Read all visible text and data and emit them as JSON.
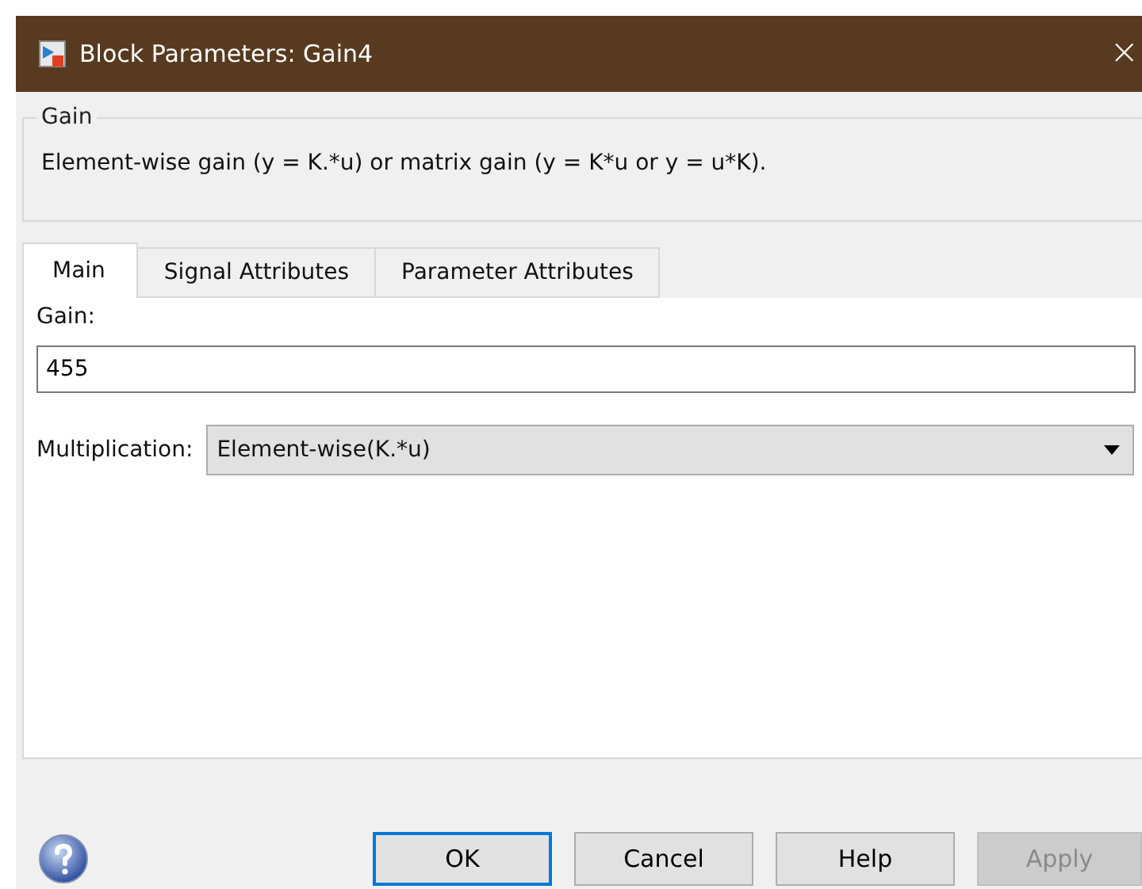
{
  "window": {
    "title": "Block Parameters: Gain4",
    "close": "×"
  },
  "group": {
    "title": "Gain",
    "description": "Element-wise gain (y = K.*u) or matrix gain (y = K*u or y = u*K)."
  },
  "tabs": [
    {
      "label": "Main",
      "selected": true
    },
    {
      "label": "Signal Attributes",
      "selected": false
    },
    {
      "label": "Parameter Attributes",
      "selected": false
    }
  ],
  "gain": {
    "label": "Gain:",
    "value": "455"
  },
  "multiplication": {
    "label": "Multiplication:",
    "value": "Element-wise(K.*u)"
  },
  "buttons": [
    {
      "label": "OK",
      "default": true,
      "disabled": false
    },
    {
      "label": "Cancel",
      "default": false,
      "disabled": false
    },
    {
      "label": "Help",
      "default": false,
      "disabled": false
    },
    {
      "label": "Apply",
      "default": false,
      "disabled": true
    }
  ]
}
